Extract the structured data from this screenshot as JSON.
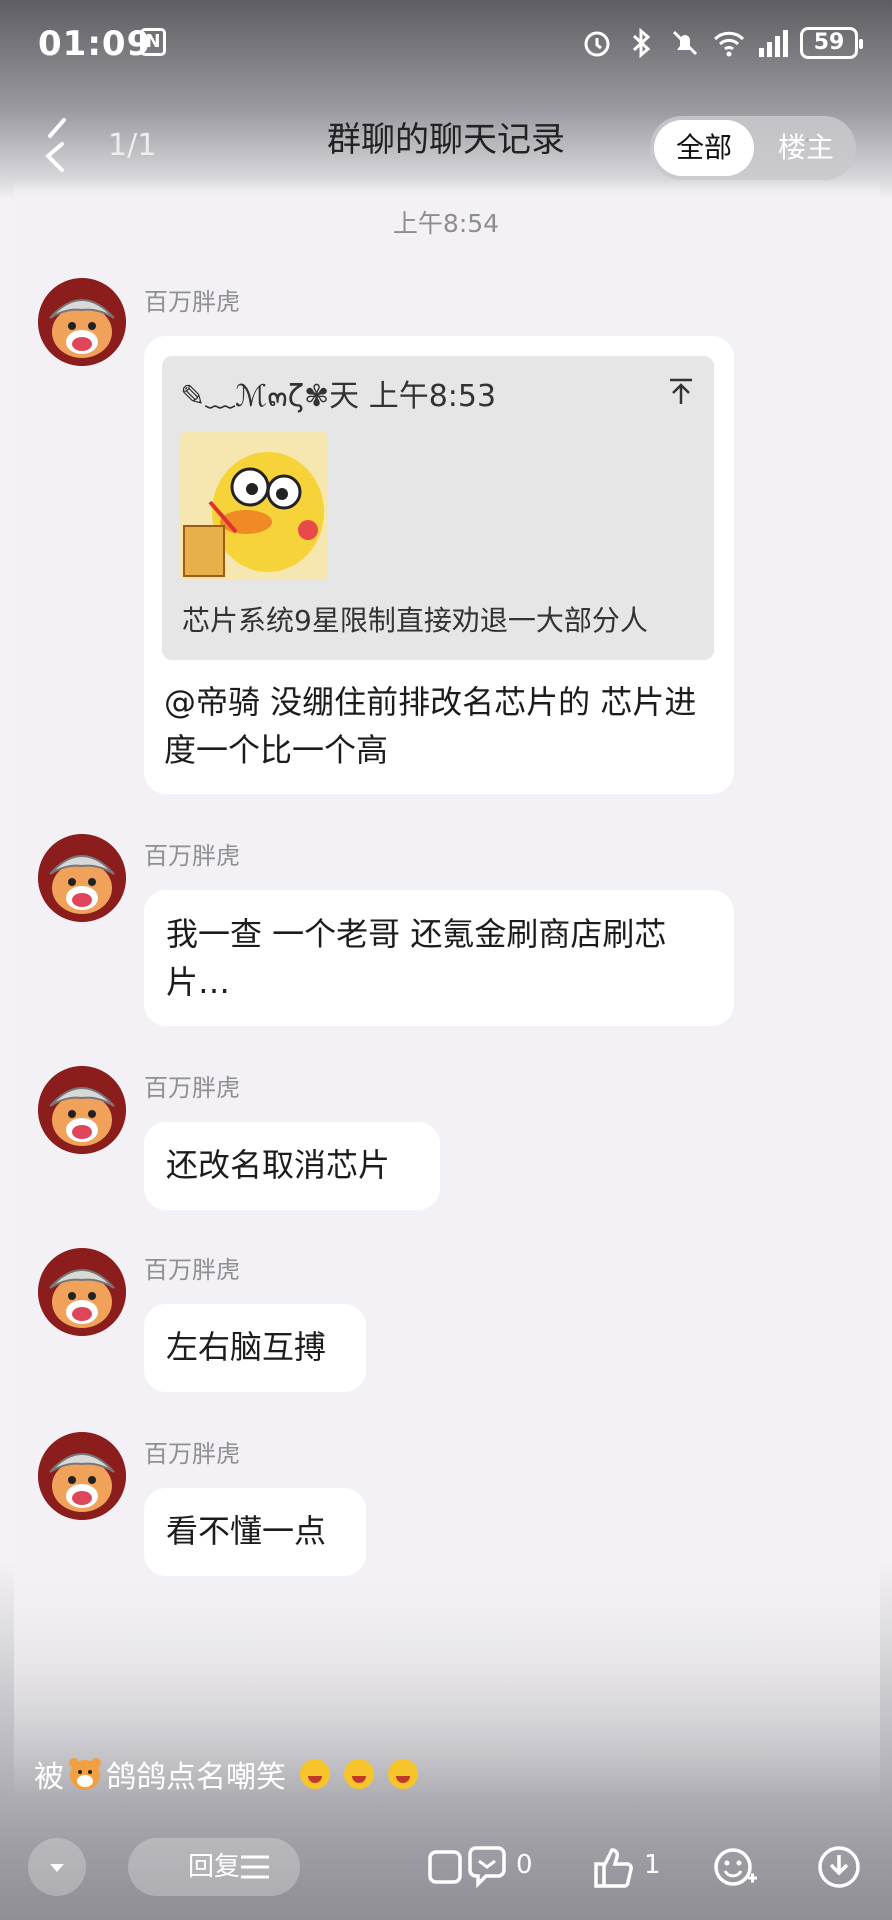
{
  "status_bar": {
    "time": "01:09",
    "n_icon": "N",
    "battery": "59"
  },
  "header": {
    "page_indicator": "1/1",
    "title": "群聊的聊天记录",
    "more": "···",
    "segment": {
      "all_label": "全部",
      "op_label": "楼主"
    }
  },
  "timestamp": "上午8:54",
  "messages": [
    {
      "sender": "百万胖虎",
      "quote": {
        "header": "✎﹏ℳ๓ζ✾天  上午8:53",
        "text": "芯片系统9星限制直接劝退一大部分人"
      },
      "text": "@帝骑 没绷住前排改名芯片的 芯片进度一个比一个高"
    },
    {
      "sender": "百万胖虎",
      "text": "我一查 一个老哥 还氪金刷商店刷芯片…"
    },
    {
      "sender": "百万胖虎",
      "text": "还改名取消芯片"
    },
    {
      "sender": "百万胖虎",
      "text": "左右脑互搏"
    },
    {
      "sender": "百万胖虎",
      "text": "看不懂一点"
    }
  ],
  "footer": {
    "reaction_prefix": "被",
    "reaction_suffix": "鸽鸽点名嘲笑",
    "reply_label": "回复",
    "comment_count": "0",
    "like_count": "1"
  },
  "icons": {
    "back": "back-chevron-icon",
    "avatar": "cartoon-bear-avatar",
    "sticker": "yellow-duck-sticker",
    "pin_top": "arrow-to-top-icon"
  }
}
